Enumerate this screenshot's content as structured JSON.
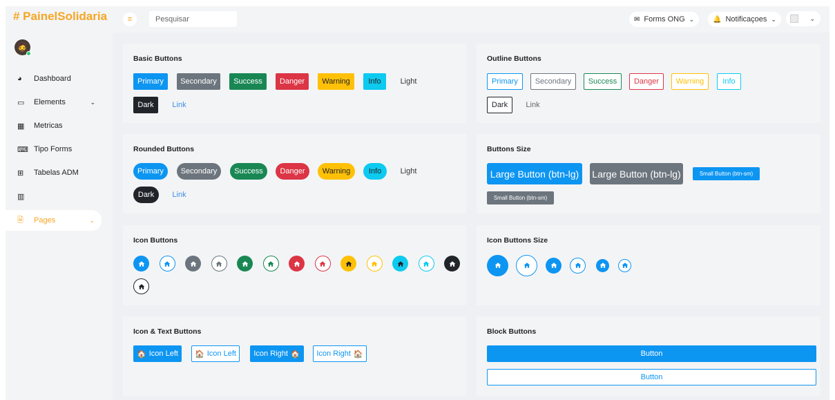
{
  "app": {
    "logo": "# PainelSolidaria"
  },
  "topbar": {
    "search_placeholder": "Pesquisar",
    "forms_label": "Forms ONG",
    "notifications_label": "Notificaçoes"
  },
  "sidebar": {
    "items": [
      {
        "label": "Dashboard",
        "icon": "dashboard-icon"
      },
      {
        "label": "Elements",
        "icon": "laptop-icon"
      },
      {
        "label": "Metricas",
        "icon": "grid-icon"
      },
      {
        "label": "Tipo Forms",
        "icon": "keyboard-icon"
      },
      {
        "label": "Tabelas ADM",
        "icon": "table-icon"
      },
      {
        "label": "",
        "icon": "chart-icon"
      },
      {
        "label": "Pages",
        "icon": "document-icon"
      }
    ],
    "active": "Pages"
  },
  "cards": {
    "basic": {
      "title": "Basic Buttons",
      "buttons": [
        "Primary",
        "Secondary",
        "Success",
        "Danger",
        "Warning",
        "Info",
        "Light",
        "Dark",
        "Link"
      ]
    },
    "outline": {
      "title": "Outline Buttons",
      "buttons": [
        "Primary",
        "Secondary",
        "Success",
        "Danger",
        "Warning",
        "Info",
        "Dark",
        "Link"
      ]
    },
    "rounded": {
      "title": "Rounded Buttons",
      "buttons": [
        "Primary",
        "Secondary",
        "Success",
        "Danger",
        "Warning",
        "Info",
        "Light",
        "Dark",
        "Link"
      ]
    },
    "size": {
      "title": "Buttons Size",
      "buttons": [
        "Large Button (btn-lg)",
        "Large Button (btn-lg)",
        "Small Button (btn-sm)",
        "Small Button (btn-sm)"
      ]
    },
    "icon": {
      "title": "Icon Buttons",
      "icon": "home-icon"
    },
    "icon_size": {
      "title": "Icon Buttons Size",
      "icon": "home-icon"
    },
    "icon_text": {
      "title": "Icon & Text Buttons",
      "buttons": [
        "Icon Left",
        "Icon Left",
        "Icon Right",
        "Icon Right"
      ]
    },
    "block": {
      "title": "Block Buttons",
      "buttons": [
        "Button",
        "Button"
      ]
    }
  },
  "colors": {
    "accent": "#f5a623",
    "primary": "#0d95f2",
    "secondary": "#6c757d",
    "success": "#198754",
    "danger": "#dc3545",
    "warning": "#ffc107",
    "info": "#0dcaf0",
    "dark": "#212529"
  }
}
